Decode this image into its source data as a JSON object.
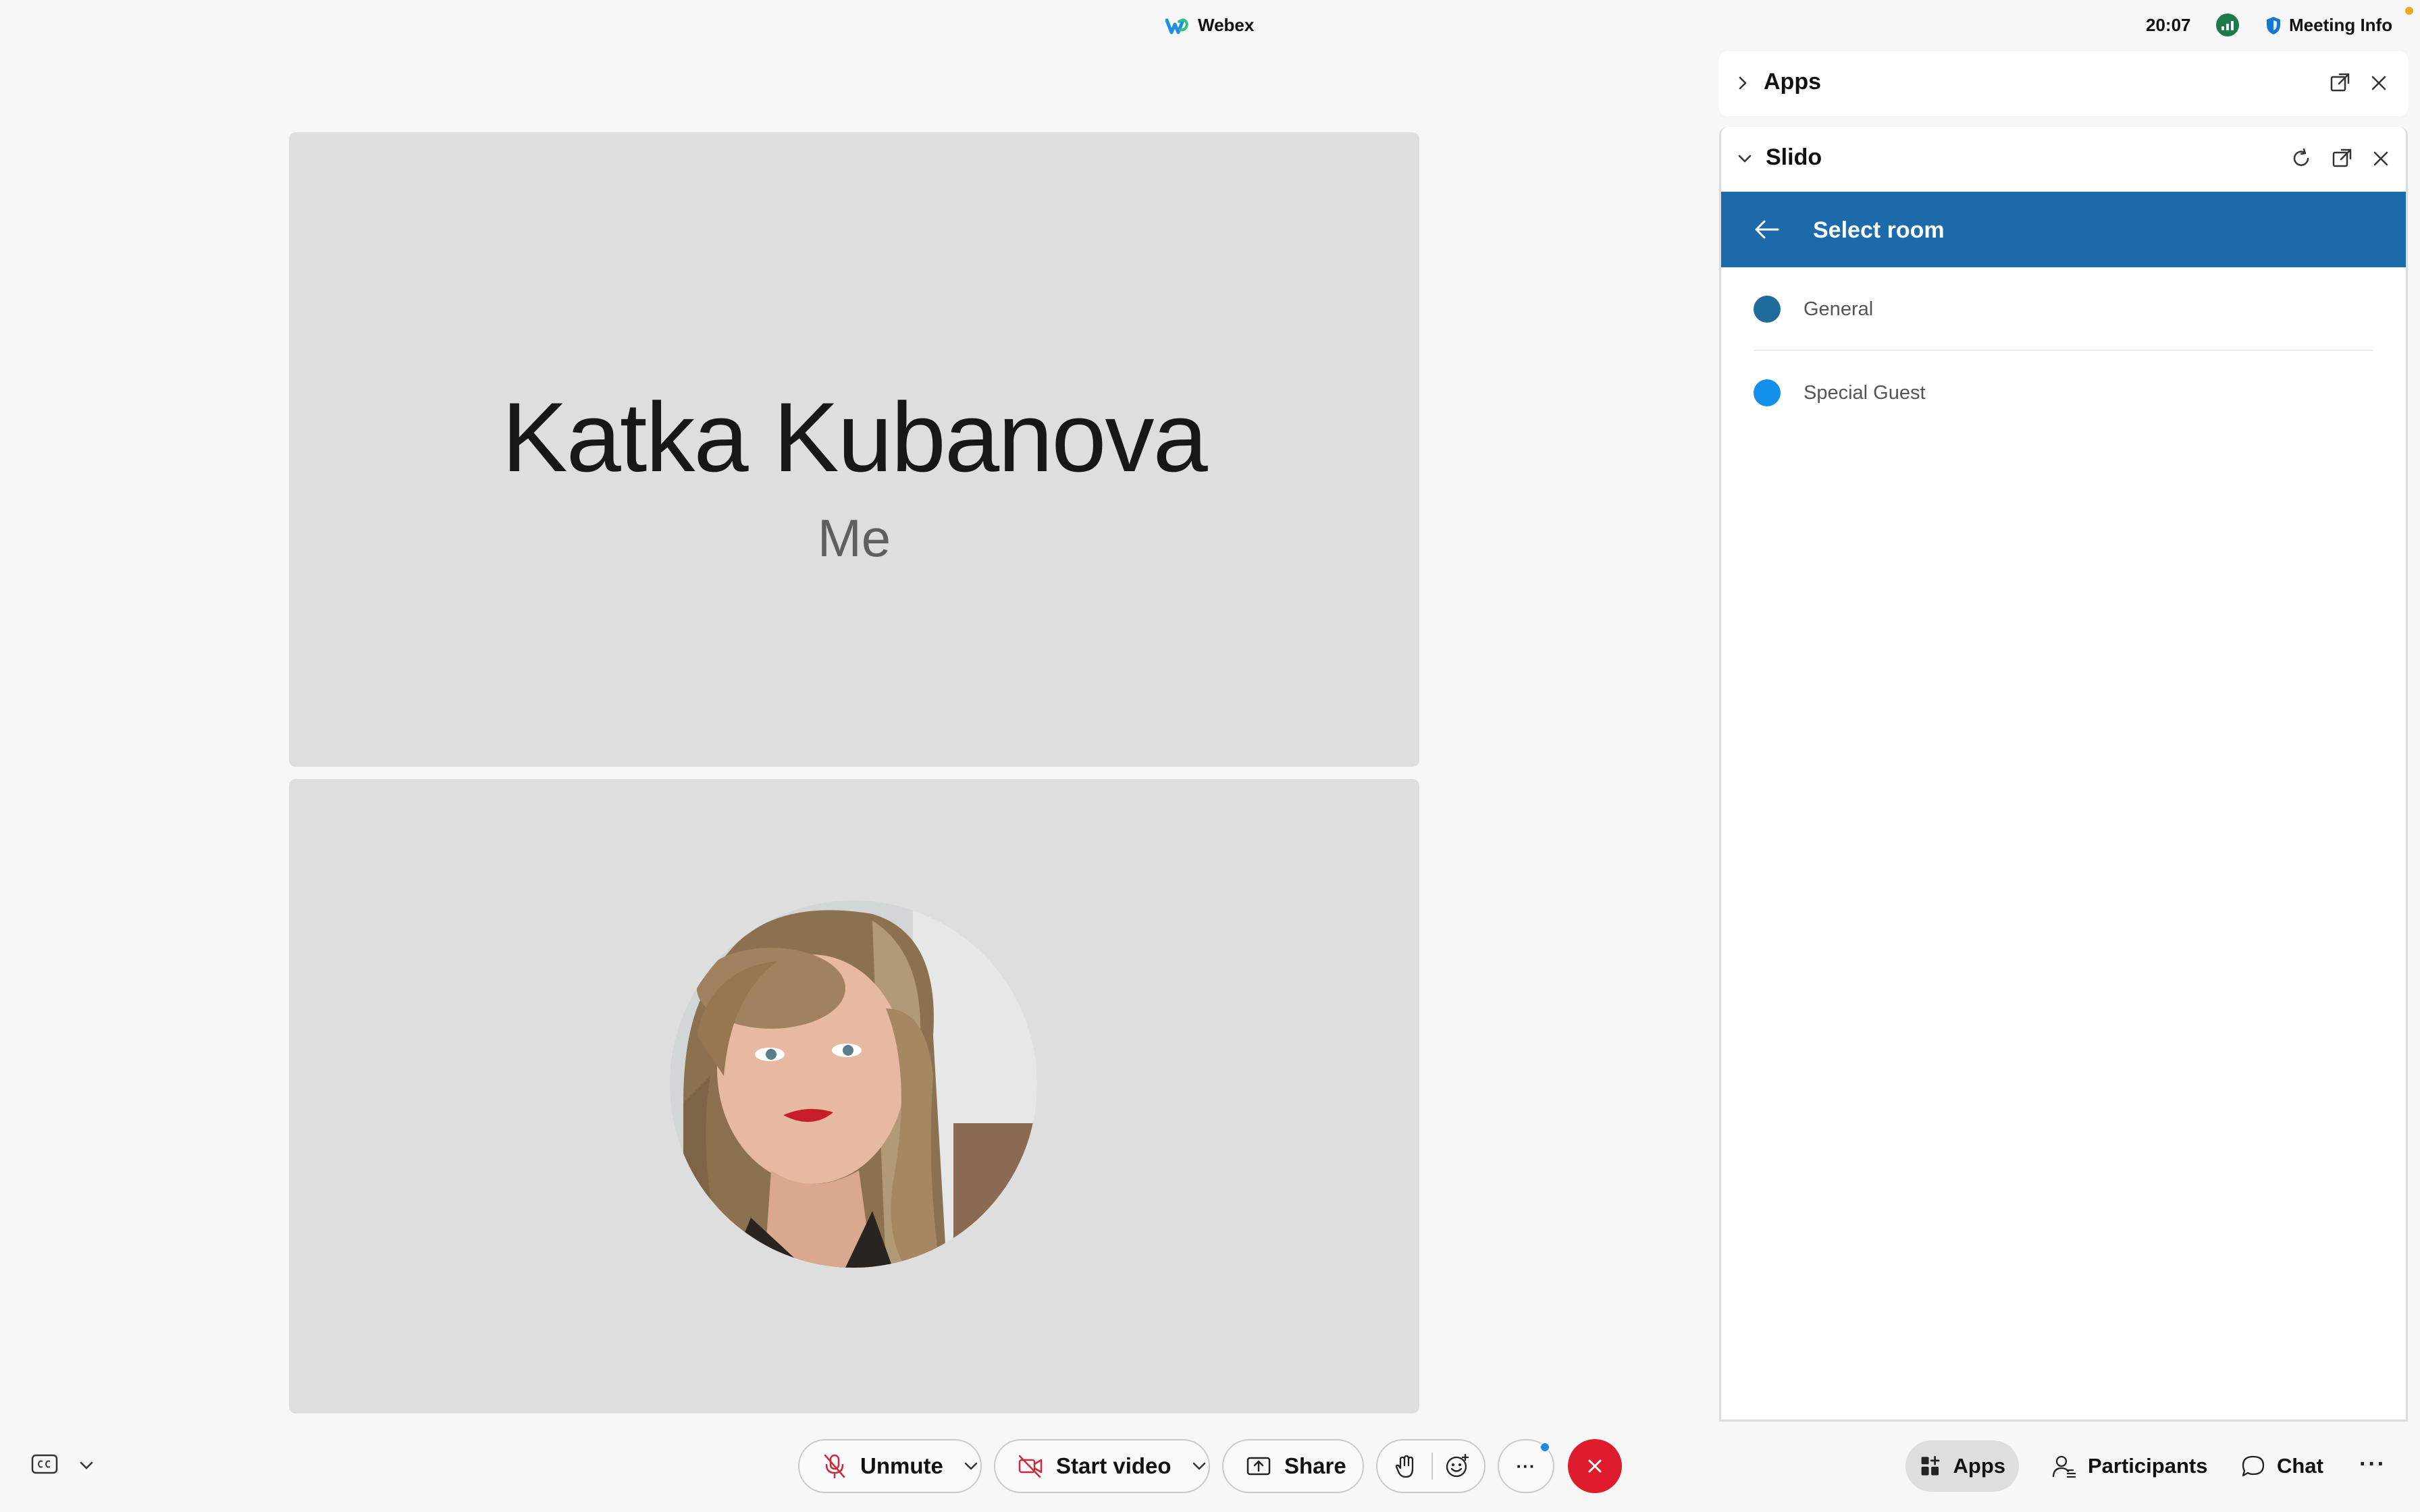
{
  "topbar": {
    "app_name": "Webex",
    "time": "20:07",
    "meeting_info": "Meeting Info"
  },
  "tiles": {
    "top_name": "Katka Kubanova",
    "top_sub": "Me"
  },
  "panel": {
    "apps_title": "Apps",
    "slido_title": "Slido",
    "slido_header": "Select room",
    "rooms": [
      {
        "label": "General",
        "color": "#1f6b9c"
      },
      {
        "label": "Special Guest",
        "color": "#1390ea"
      }
    ]
  },
  "toolbar": {
    "unmute": "Unmute",
    "start_video": "Start video",
    "share": "Share",
    "more": "···",
    "apps": "Apps",
    "participants": "Participants",
    "chat": "Chat",
    "overflow": "···"
  },
  "colors": {
    "slido_blue": "#1d6aab",
    "end_red": "#df1c2e",
    "mute_red": "#d0283a"
  }
}
